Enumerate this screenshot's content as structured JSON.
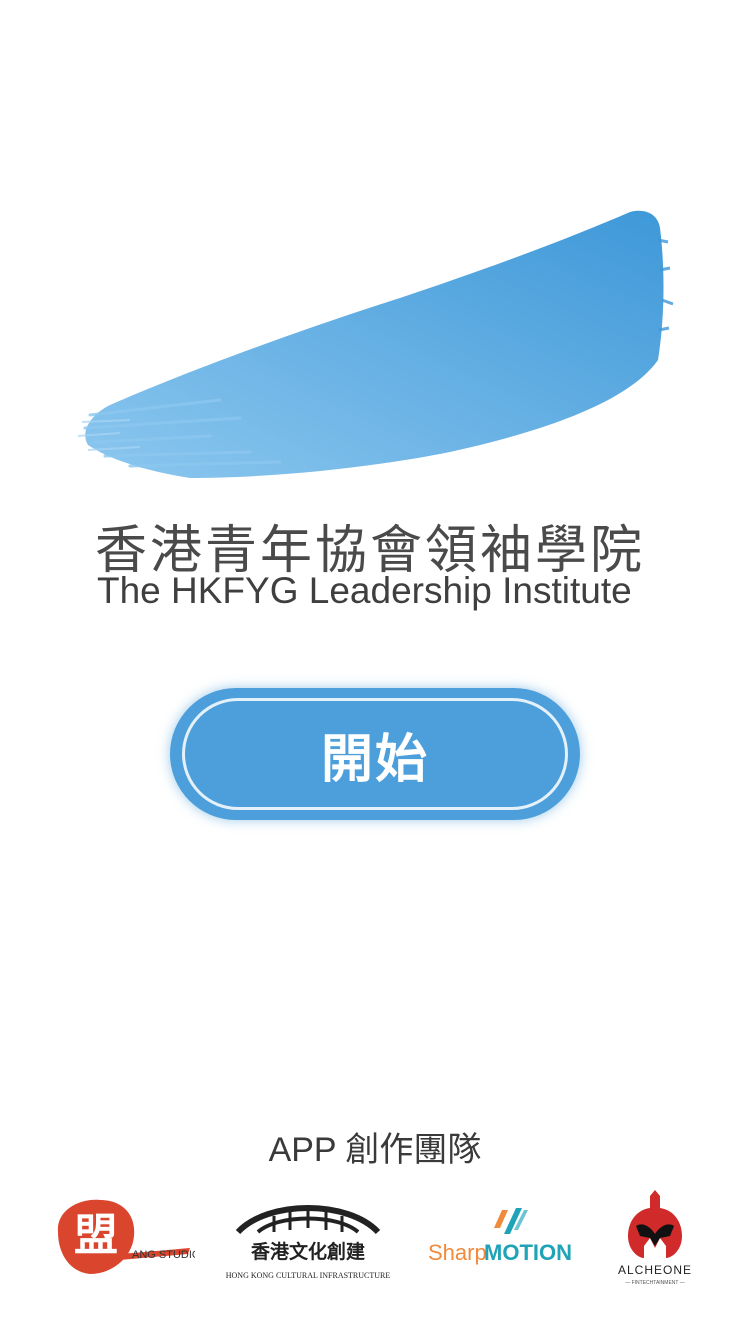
{
  "header": {
    "title_cn": "香港青年協會領袖學院",
    "title_en": "The HKFYG Leadership Institute"
  },
  "start_button": {
    "label": "開始"
  },
  "credits": {
    "title": "APP 創作團隊",
    "logos": [
      {
        "name": "ang-studio-logo",
        "mark": "盟",
        "text": "ANG STUDIO"
      },
      {
        "name": "hk-cultural-infrastructure-logo",
        "text_cn": "香港文化創建",
        "text_en": "HONG KONG CULTURAL INFRASTRUCTURE"
      },
      {
        "name": "sharpmotion-logo",
        "text_a": "Sharp",
        "text_b": "MOTION"
      },
      {
        "name": "alcheone-logo",
        "text": "ALCHEONE",
        "sub": "— FINTECHTAINMENT —"
      }
    ]
  },
  "colors": {
    "accent": "#4d9fdb",
    "brush_light": "#8cc7ef",
    "brush_dark": "#3e98d8",
    "ang_red": "#d9452d",
    "sharp_orange": "#f08a3c",
    "sharp_teal": "#1ea3b7",
    "alch_red": "#d02a2a"
  }
}
